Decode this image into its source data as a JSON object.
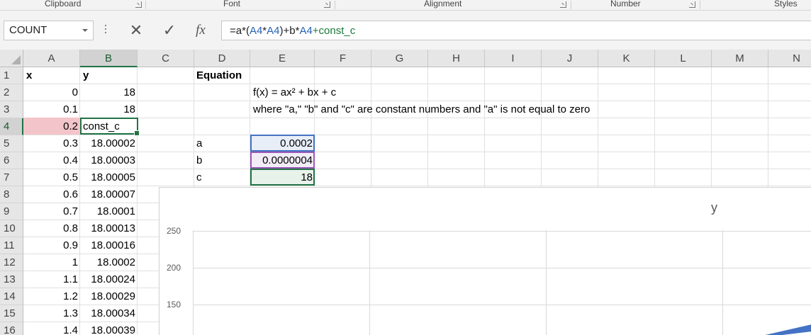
{
  "ribbon": {
    "groups": [
      "Clipboard",
      "Font",
      "Alignment",
      "Number",
      "Styles"
    ]
  },
  "formula_bar": {
    "name_box": "COUNT",
    "cancel_icon": "✕",
    "enter_icon": "✓",
    "fx_label": "fx",
    "formula_parts": [
      {
        "text": "=a*(",
        "color": "plain"
      },
      {
        "text": "A4",
        "color": "blue"
      },
      {
        "text": "*",
        "color": "plain"
      },
      {
        "text": "A4",
        "color": "blue"
      },
      {
        "text": ")+b*",
        "color": "plain"
      },
      {
        "text": "A4",
        "color": "blue"
      },
      {
        "text": "+const_c",
        "color": "green"
      }
    ]
  },
  "columns": [
    "A",
    "B",
    "C",
    "D",
    "E",
    "F",
    "G",
    "H",
    "I",
    "J",
    "K",
    "L",
    "M",
    "N"
  ],
  "rows": [
    "1",
    "2",
    "3",
    "4",
    "5",
    "6",
    "7",
    "8",
    "9",
    "10",
    "11",
    "12",
    "13",
    "14",
    "15",
    "16"
  ],
  "active": {
    "column": "B",
    "row": "4"
  },
  "table": {
    "header_x": "x",
    "header_y": "y",
    "x": [
      "0",
      "0.1",
      "0.2",
      "0.3",
      "0.4",
      "0.5",
      "0.6",
      "0.7",
      "0.8",
      "0.9",
      "1",
      "1.1",
      "1.2",
      "1.3",
      "1.4"
    ],
    "y": [
      "18",
      "18",
      "const_c",
      "18.00002",
      "18.00003",
      "18.00005",
      "18.00007",
      "18.0001",
      "18.00013",
      "18.00016",
      "18.0002",
      "18.00024",
      "18.00029",
      "18.00034",
      "18.00039"
    ]
  },
  "equation": {
    "title": "Equation",
    "formula": "f(x) = ax² + bx + c",
    "description": "where \"a,\" \"b\" and \"c\" are constant numbers and \"a\" is not equal to zero"
  },
  "constants": [
    {
      "label": "a",
      "value": "0.0002",
      "color": "#4472c4"
    },
    {
      "label": "b",
      "value": "0.0000004",
      "color": "#9b59b6"
    },
    {
      "label": "c",
      "value": "18",
      "color": "#217346"
    }
  ],
  "colors": {
    "selection_green": "#217346",
    "a_ref_fill": "#e8eef8",
    "b_ref_fill": "#f2ecf8",
    "c_ref_fill": "#e6f2ea",
    "a4_ref_fill": "#f3c5ca",
    "series": "#4472c4"
  },
  "chart_data": {
    "type": "line",
    "title": "y",
    "y_ticks": [
      "250",
      "200",
      "150"
    ],
    "ylim": [
      100,
      250
    ],
    "series": [
      {
        "values": [
          18,
          18,
          18,
          18.00002,
          18.00003,
          18.00005,
          18.00007,
          18.0001,
          18.00013,
          18.00016,
          18.0002,
          18.00024,
          18.00029,
          18.00034,
          18.00039
        ]
      }
    ]
  }
}
